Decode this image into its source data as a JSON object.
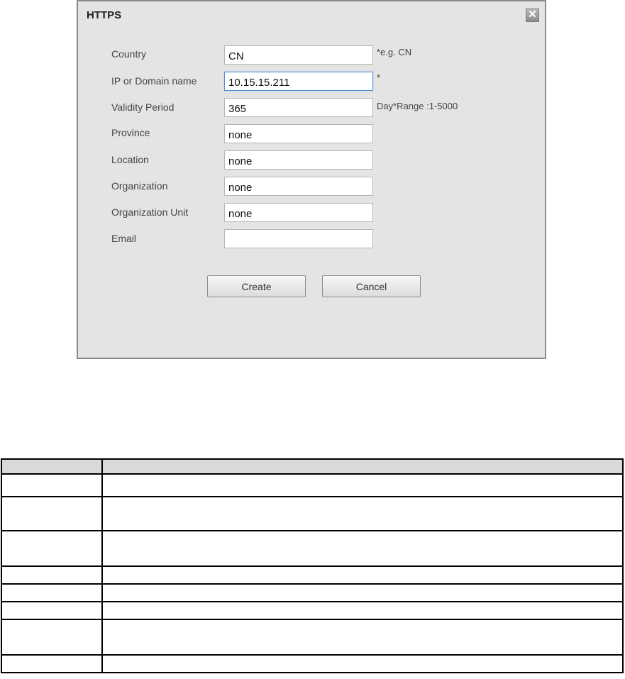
{
  "dialog": {
    "title": "HTTPS",
    "close_glyph": "✕",
    "fields": [
      {
        "label": "Country",
        "value": "CN",
        "hint": "*e.g. CN"
      },
      {
        "label": "IP or Domain name",
        "value": "10.15.15.211",
        "hint": "*"
      },
      {
        "label": "Validity Period",
        "value": "365",
        "hint": "Day*Range :1-5000"
      },
      {
        "label": "Province",
        "value": "none",
        "hint": ""
      },
      {
        "label": "Location",
        "value": "none",
        "hint": ""
      },
      {
        "label": "Organization",
        "value": "none",
        "hint": ""
      },
      {
        "label": "Organization Unit",
        "value": "none",
        "hint": ""
      },
      {
        "label": "Email",
        "value": "",
        "hint": ""
      }
    ],
    "create_label": "Create",
    "cancel_label": "Cancel"
  },
  "table": {
    "header": [
      "",
      ""
    ],
    "rows": [
      [
        "",
        ""
      ],
      [
        "",
        ""
      ],
      [
        "",
        ""
      ],
      [
        "",
        ""
      ],
      [
        "",
        ""
      ],
      [
        "",
        ""
      ],
      [
        "",
        ""
      ],
      [
        "",
        ""
      ]
    ]
  }
}
